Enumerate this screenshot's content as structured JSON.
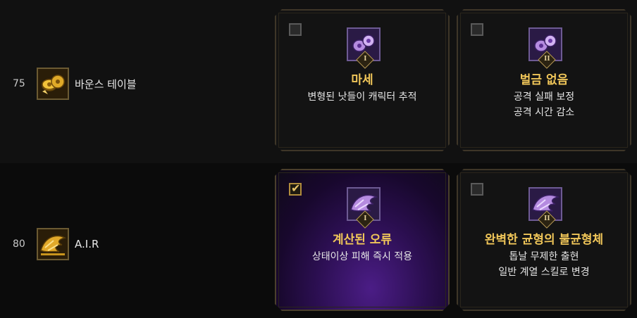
{
  "rows": [
    {
      "level": "75",
      "skill_name": "바운스 테이블",
      "icon": "coin-stack-icon",
      "options": [
        {
          "numeral": "I",
          "checked": false,
          "title": "마세",
          "desc": [
            "변형된 낫들이 캐릭터 추적"
          ],
          "icon": "coin-rune-icon"
        },
        {
          "numeral": "II",
          "checked": false,
          "title": "벌금 없음",
          "desc": [
            "공격 실패 보정",
            "공격 시간 감소"
          ],
          "icon": "coin-rune-icon"
        }
      ]
    },
    {
      "level": "80",
      "skill_name": "A.I.R",
      "icon": "beast-claw-icon",
      "options": [
        {
          "numeral": "I",
          "checked": true,
          "title": "계산된 오류",
          "desc": [
            "상태이상 피해 즉시 적용"
          ],
          "icon": "claw-rune-icon"
        },
        {
          "numeral": "II",
          "checked": false,
          "title": "완벽한 균형의 불균형체",
          "desc": [
            "톱날 무제한 출현",
            "일반 계열 스킬로 변경"
          ],
          "icon": "claw-rune-icon"
        }
      ]
    }
  ],
  "colors": {
    "title_gold": "#f0c659",
    "selected_purple": "#4b1d86",
    "frame_border": "#3e3628"
  }
}
